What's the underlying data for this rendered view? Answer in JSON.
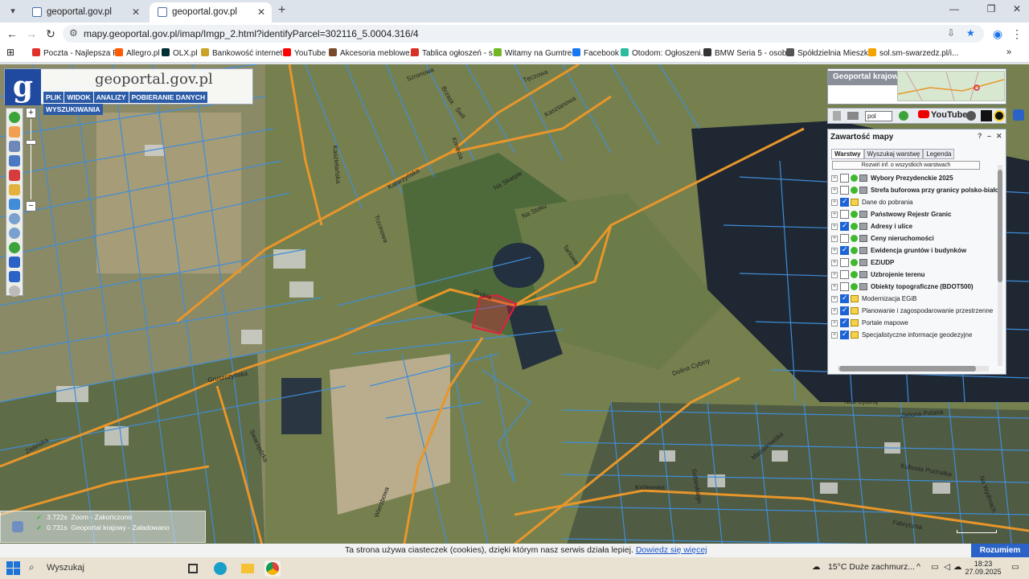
{
  "browser": {
    "tabs": [
      {
        "title": "geoportal.gov.pl",
        "active": false
      },
      {
        "title": "geoportal.gov.pl",
        "active": true
      }
    ],
    "url": "mapy.geoportal.gov.pl/imap/Imgp_2.html?identifyParcel=302116_5.0004.316/4",
    "bookmarks": [
      {
        "label": "Poczta - Najlepsza P...",
        "color": "#e0312a"
      },
      {
        "label": "Allegro.pl",
        "color": "#ff5a00"
      },
      {
        "label": "OLX.pl",
        "color": "#002f34"
      },
      {
        "label": "Bankowość internet...",
        "color": "#c9a227"
      },
      {
        "label": "YouTube",
        "color": "#ff0000"
      },
      {
        "label": "Akcesoria meblowe,...",
        "color": "#7a4a2a"
      },
      {
        "label": "Tablica ogłoszeń - s...",
        "color": "#d93025"
      },
      {
        "label": "Witamy na Gumtree!",
        "color": "#72b626"
      },
      {
        "label": "Facebook",
        "color": "#1877f2"
      },
      {
        "label": "Otodom: Ogłoszeni...",
        "color": "#2bbb9f"
      },
      {
        "label": "BMW Seria 5 - osob...",
        "color": "#333333"
      },
      {
        "label": "Spółdzielnia Mieszk...",
        "color": "#555555"
      },
      {
        "label": "sol.sm-swarzedz.pl/i...",
        "color": "#f4a300"
      }
    ]
  },
  "app": {
    "logo_letter": "g",
    "title": "geoportal.gov.pl",
    "menu": [
      "PLIK",
      "WIDOK",
      "ANALIZY",
      "POBIERANIE DANYCH",
      "WYSZUKIWANIA"
    ],
    "overview_label": "Geoportal krajowy",
    "language": "pol",
    "youtube_label": "YouTube"
  },
  "layers_panel": {
    "title": "Zawartość mapy",
    "tabs": [
      "Warstwy",
      "Wyszukaj warstwę",
      "Legenda"
    ],
    "expand_all": "Rozwiń inf. o wszystkich warstwach",
    "items": [
      {
        "name": "Wybory Prezydenckie 2025",
        "checked": false,
        "bold": true,
        "dot": true,
        "doc": false
      },
      {
        "name": "Strefa buforowa przy granicy polsko-biało",
        "checked": false,
        "bold": true,
        "dot": true,
        "doc": false
      },
      {
        "name": "Dane do pobrania",
        "checked": true,
        "bold": false,
        "dot": false,
        "doc": true
      },
      {
        "name": "Państwowy Rejestr Granic",
        "checked": false,
        "bold": true,
        "dot": true,
        "doc": false
      },
      {
        "name": "Adresy i ulice",
        "checked": true,
        "bold": true,
        "dot": true,
        "doc": false
      },
      {
        "name": "Ceny nieruchomości",
        "checked": false,
        "bold": true,
        "dot": true,
        "doc": false
      },
      {
        "name": "Ewidencja gruntów i budynków",
        "checked": true,
        "bold": true,
        "dot": true,
        "doc": false
      },
      {
        "name": "EZiUDP",
        "checked": false,
        "bold": true,
        "dot": true,
        "doc": false
      },
      {
        "name": "Uzbrojenie terenu",
        "checked": false,
        "bold": true,
        "dot": true,
        "doc": false
      },
      {
        "name": "Obiekty topograficzne (BDOT500)",
        "checked": false,
        "bold": true,
        "dot": true,
        "doc": false
      },
      {
        "name": "Modernizacja EGiB",
        "checked": true,
        "bold": false,
        "dot": false,
        "doc": true
      },
      {
        "name": "Planowanie i zagospodarowanie przestrzenne",
        "checked": true,
        "bold": false,
        "dot": false,
        "doc": true
      },
      {
        "name": "Portale mapowe",
        "checked": true,
        "bold": false,
        "dot": false,
        "doc": true
      },
      {
        "name": "Specjalistyczne informacje geodezyjne",
        "checked": true,
        "bold": false,
        "dot": false,
        "doc": true
      }
    ]
  },
  "map": {
    "street_labels": [
      "Szronowa",
      "Brzask",
      "Świt",
      "Tęczowa",
      "Kasztanowa",
      "Katarzyńska",
      "Kmiecia",
      "Kasztelańska",
      "Na Stoku",
      "Na Skarpie",
      "Trzcinowa",
      "Tarłowa",
      "Grobla",
      "Gruszczyńska",
      "Zielińska",
      "Swarzędzka",
      "Dolina Cybiny",
      "Nad Cybiną",
      "Zielona Polana",
      "Królewska",
      "Kubusia Puchatka",
      "Fabryczna",
      "Wierzbowa",
      "Mazurkowska",
      "Sobieskiego",
      "Na Wydmach"
    ],
    "parcel_highlight_color": "#e0203c",
    "road_color": "#e8962a",
    "parcel_line_color": "#3f8dd8"
  },
  "status_log": [
    {
      "time": "3.722s",
      "text": "Zoom - Zakończono"
    },
    {
      "time": "0.731s",
      "text": "Geoportal krajowy - Załadowano"
    }
  ],
  "cookie_bar": {
    "text": "Ta strona używa ciasteczek (cookies), dzięki którym nasz serwis działa lepiej.",
    "link": "Dowiedz się więcej",
    "button": "Rozumiem"
  },
  "taskbar": {
    "search_placeholder": "Wyszukaj",
    "weather": "15°C  Duże zachmurz...",
    "time": "18:23",
    "date": "27.09.2025"
  }
}
